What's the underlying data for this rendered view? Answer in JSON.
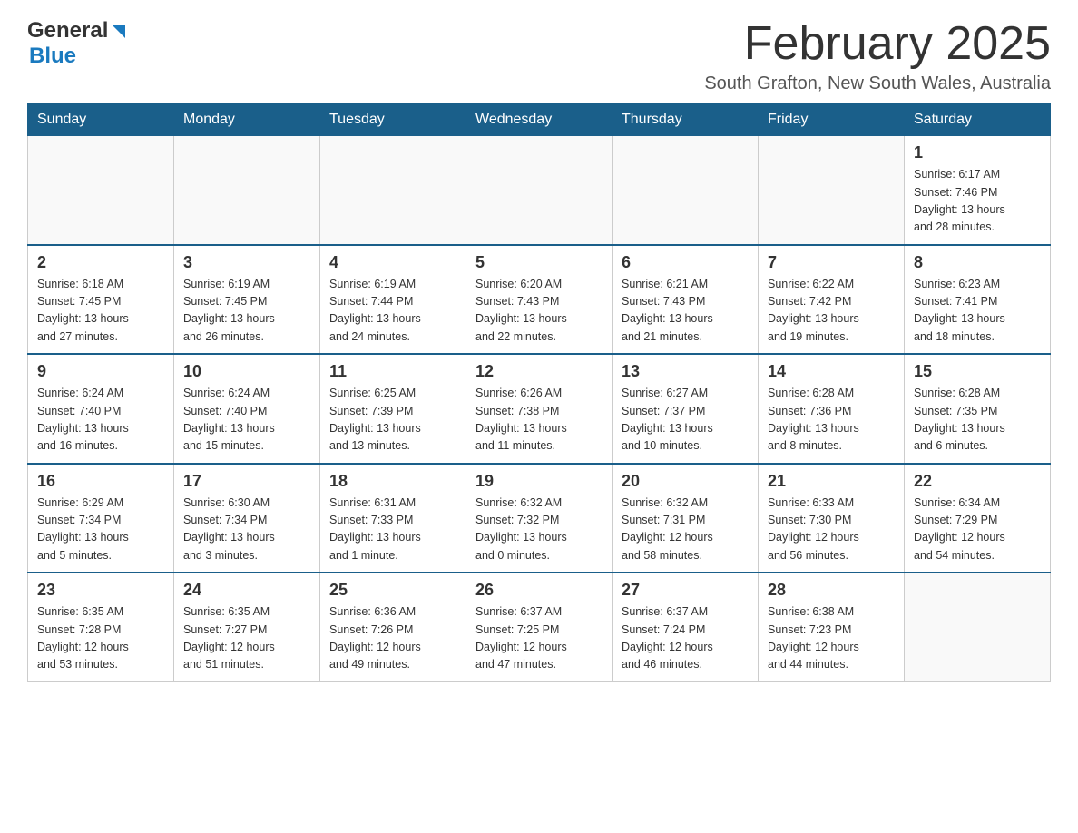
{
  "header": {
    "logo_general": "General",
    "logo_blue": "Blue",
    "month_title": "February 2025",
    "location": "South Grafton, New South Wales, Australia"
  },
  "days_of_week": [
    "Sunday",
    "Monday",
    "Tuesday",
    "Wednesday",
    "Thursday",
    "Friday",
    "Saturday"
  ],
  "weeks": [
    {
      "days": [
        {
          "num": "",
          "info": ""
        },
        {
          "num": "",
          "info": ""
        },
        {
          "num": "",
          "info": ""
        },
        {
          "num": "",
          "info": ""
        },
        {
          "num": "",
          "info": ""
        },
        {
          "num": "",
          "info": ""
        },
        {
          "num": "1",
          "info": "Sunrise: 6:17 AM\nSunset: 7:46 PM\nDaylight: 13 hours\nand 28 minutes."
        }
      ]
    },
    {
      "days": [
        {
          "num": "2",
          "info": "Sunrise: 6:18 AM\nSunset: 7:45 PM\nDaylight: 13 hours\nand 27 minutes."
        },
        {
          "num": "3",
          "info": "Sunrise: 6:19 AM\nSunset: 7:45 PM\nDaylight: 13 hours\nand 26 minutes."
        },
        {
          "num": "4",
          "info": "Sunrise: 6:19 AM\nSunset: 7:44 PM\nDaylight: 13 hours\nand 24 minutes."
        },
        {
          "num": "5",
          "info": "Sunrise: 6:20 AM\nSunset: 7:43 PM\nDaylight: 13 hours\nand 22 minutes."
        },
        {
          "num": "6",
          "info": "Sunrise: 6:21 AM\nSunset: 7:43 PM\nDaylight: 13 hours\nand 21 minutes."
        },
        {
          "num": "7",
          "info": "Sunrise: 6:22 AM\nSunset: 7:42 PM\nDaylight: 13 hours\nand 19 minutes."
        },
        {
          "num": "8",
          "info": "Sunrise: 6:23 AM\nSunset: 7:41 PM\nDaylight: 13 hours\nand 18 minutes."
        }
      ]
    },
    {
      "days": [
        {
          "num": "9",
          "info": "Sunrise: 6:24 AM\nSunset: 7:40 PM\nDaylight: 13 hours\nand 16 minutes."
        },
        {
          "num": "10",
          "info": "Sunrise: 6:24 AM\nSunset: 7:40 PM\nDaylight: 13 hours\nand 15 minutes."
        },
        {
          "num": "11",
          "info": "Sunrise: 6:25 AM\nSunset: 7:39 PM\nDaylight: 13 hours\nand 13 minutes."
        },
        {
          "num": "12",
          "info": "Sunrise: 6:26 AM\nSunset: 7:38 PM\nDaylight: 13 hours\nand 11 minutes."
        },
        {
          "num": "13",
          "info": "Sunrise: 6:27 AM\nSunset: 7:37 PM\nDaylight: 13 hours\nand 10 minutes."
        },
        {
          "num": "14",
          "info": "Sunrise: 6:28 AM\nSunset: 7:36 PM\nDaylight: 13 hours\nand 8 minutes."
        },
        {
          "num": "15",
          "info": "Sunrise: 6:28 AM\nSunset: 7:35 PM\nDaylight: 13 hours\nand 6 minutes."
        }
      ]
    },
    {
      "days": [
        {
          "num": "16",
          "info": "Sunrise: 6:29 AM\nSunset: 7:34 PM\nDaylight: 13 hours\nand 5 minutes."
        },
        {
          "num": "17",
          "info": "Sunrise: 6:30 AM\nSunset: 7:34 PM\nDaylight: 13 hours\nand 3 minutes."
        },
        {
          "num": "18",
          "info": "Sunrise: 6:31 AM\nSunset: 7:33 PM\nDaylight: 13 hours\nand 1 minute."
        },
        {
          "num": "19",
          "info": "Sunrise: 6:32 AM\nSunset: 7:32 PM\nDaylight: 13 hours\nand 0 minutes."
        },
        {
          "num": "20",
          "info": "Sunrise: 6:32 AM\nSunset: 7:31 PM\nDaylight: 12 hours\nand 58 minutes."
        },
        {
          "num": "21",
          "info": "Sunrise: 6:33 AM\nSunset: 7:30 PM\nDaylight: 12 hours\nand 56 minutes."
        },
        {
          "num": "22",
          "info": "Sunrise: 6:34 AM\nSunset: 7:29 PM\nDaylight: 12 hours\nand 54 minutes."
        }
      ]
    },
    {
      "days": [
        {
          "num": "23",
          "info": "Sunrise: 6:35 AM\nSunset: 7:28 PM\nDaylight: 12 hours\nand 53 minutes."
        },
        {
          "num": "24",
          "info": "Sunrise: 6:35 AM\nSunset: 7:27 PM\nDaylight: 12 hours\nand 51 minutes."
        },
        {
          "num": "25",
          "info": "Sunrise: 6:36 AM\nSunset: 7:26 PM\nDaylight: 12 hours\nand 49 minutes."
        },
        {
          "num": "26",
          "info": "Sunrise: 6:37 AM\nSunset: 7:25 PM\nDaylight: 12 hours\nand 47 minutes."
        },
        {
          "num": "27",
          "info": "Sunrise: 6:37 AM\nSunset: 7:24 PM\nDaylight: 12 hours\nand 46 minutes."
        },
        {
          "num": "28",
          "info": "Sunrise: 6:38 AM\nSunset: 7:23 PM\nDaylight: 12 hours\nand 44 minutes."
        },
        {
          "num": "",
          "info": ""
        }
      ]
    }
  ]
}
